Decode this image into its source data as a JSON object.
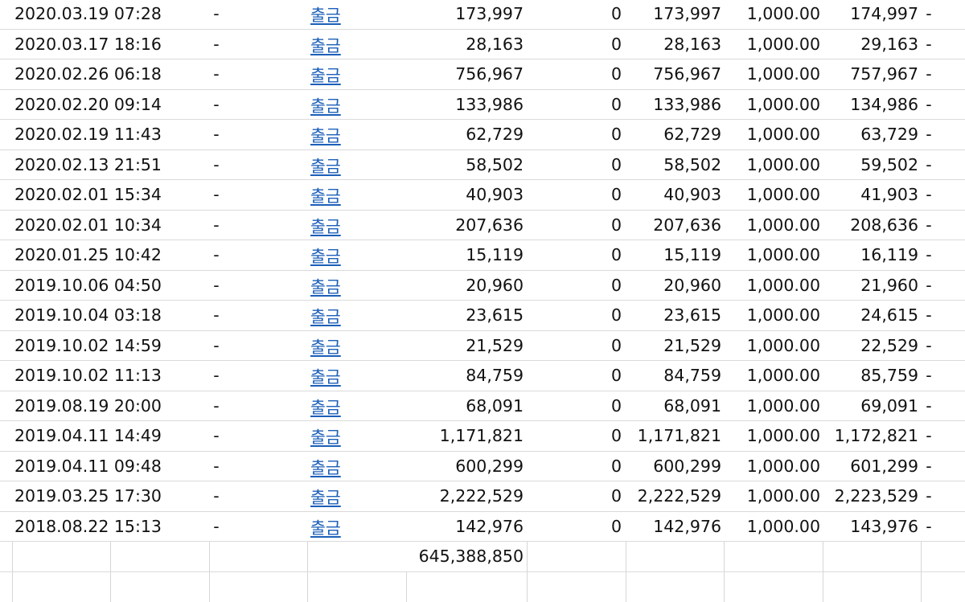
{
  "sheet": {
    "rows": [
      {
        "datetime": "2020.03.19 07:28",
        "col2": "-",
        "type": "출금",
        "amount": "173,997",
        "zero": "0",
        "amount2": "173,997",
        "rate": "1,000.00",
        "total": "174,997",
        "col9": "-"
      },
      {
        "datetime": "2020.03.17 18:16",
        "col2": "-",
        "type": "출금",
        "amount": "28,163",
        "zero": "0",
        "amount2": "28,163",
        "rate": "1,000.00",
        "total": "29,163",
        "col9": "-"
      },
      {
        "datetime": "2020.02.26 06:18",
        "col2": "-",
        "type": "출금",
        "amount": "756,967",
        "zero": "0",
        "amount2": "756,967",
        "rate": "1,000.00",
        "total": "757,967",
        "col9": "-"
      },
      {
        "datetime": "2020.02.20 09:14",
        "col2": "-",
        "type": "출금",
        "amount": "133,986",
        "zero": "0",
        "amount2": "133,986",
        "rate": "1,000.00",
        "total": "134,986",
        "col9": "-"
      },
      {
        "datetime": "2020.02.19 11:43",
        "col2": "-",
        "type": "출금",
        "amount": "62,729",
        "zero": "0",
        "amount2": "62,729",
        "rate": "1,000.00",
        "total": "63,729",
        "col9": "-"
      },
      {
        "datetime": "2020.02.13 21:51",
        "col2": "-",
        "type": "출금",
        "amount": "58,502",
        "zero": "0",
        "amount2": "58,502",
        "rate": "1,000.00",
        "total": "59,502",
        "col9": "-"
      },
      {
        "datetime": "2020.02.01 15:34",
        "col2": "-",
        "type": "출금",
        "amount": "40,903",
        "zero": "0",
        "amount2": "40,903",
        "rate": "1,000.00",
        "total": "41,903",
        "col9": "-"
      },
      {
        "datetime": "2020.02.01 10:34",
        "col2": "-",
        "type": "출금",
        "amount": "207,636",
        "zero": "0",
        "amount2": "207,636",
        "rate": "1,000.00",
        "total": "208,636",
        "col9": "-"
      },
      {
        "datetime": "2020.01.25 10:42",
        "col2": "-",
        "type": "출금",
        "amount": "15,119",
        "zero": "0",
        "amount2": "15,119",
        "rate": "1,000.00",
        "total": "16,119",
        "col9": "-"
      },
      {
        "datetime": "2019.10.06 04:50",
        "col2": "-",
        "type": "출금",
        "amount": "20,960",
        "zero": "0",
        "amount2": "20,960",
        "rate": "1,000.00",
        "total": "21,960",
        "col9": "-"
      },
      {
        "datetime": "2019.10.04 03:18",
        "col2": "-",
        "type": "출금",
        "amount": "23,615",
        "zero": "0",
        "amount2": "23,615",
        "rate": "1,000.00",
        "total": "24,615",
        "col9": "-"
      },
      {
        "datetime": "2019.10.02 14:59",
        "col2": "-",
        "type": "출금",
        "amount": "21,529",
        "zero": "0",
        "amount2": "21,529",
        "rate": "1,000.00",
        "total": "22,529",
        "col9": "-"
      },
      {
        "datetime": "2019.10.02 11:13",
        "col2": "-",
        "type": "출금",
        "amount": "84,759",
        "zero": "0",
        "amount2": "84,759",
        "rate": "1,000.00",
        "total": "85,759",
        "col9": "-"
      },
      {
        "datetime": "2019.08.19 20:00",
        "col2": "-",
        "type": "출금",
        "amount": "68,091",
        "zero": "0",
        "amount2": "68,091",
        "rate": "1,000.00",
        "total": "69,091",
        "col9": "-"
      },
      {
        "datetime": "2019.04.11 14:49",
        "col2": "-",
        "type": "출금",
        "amount": "1,171,821",
        "zero": "0",
        "amount2": "1,171,821",
        "rate": "1,000.00",
        "total": "1,172,821",
        "col9": "-"
      },
      {
        "datetime": "2019.04.11 09:48",
        "col2": "-",
        "type": "출금",
        "amount": "600,299",
        "zero": "0",
        "amount2": "600,299",
        "rate": "1,000.00",
        "total": "601,299",
        "col9": "-"
      },
      {
        "datetime": "2019.03.25 17:30",
        "col2": "-",
        "type": "출금",
        "amount": "2,222,529",
        "zero": "0",
        "amount2": "2,222,529",
        "rate": "1,000.00",
        "total": "2,223,529",
        "col9": "-"
      },
      {
        "datetime": "2018.08.22 15:13",
        "col2": "-",
        "type": "출금",
        "amount": "142,976",
        "zero": "0",
        "amount2": "142,976",
        "rate": "1,000.00",
        "total": "143,976",
        "col9": "-"
      }
    ],
    "sum": "645,388,850"
  },
  "colors": {
    "link": "#1c5fb8",
    "gridline": "#dadada"
  }
}
